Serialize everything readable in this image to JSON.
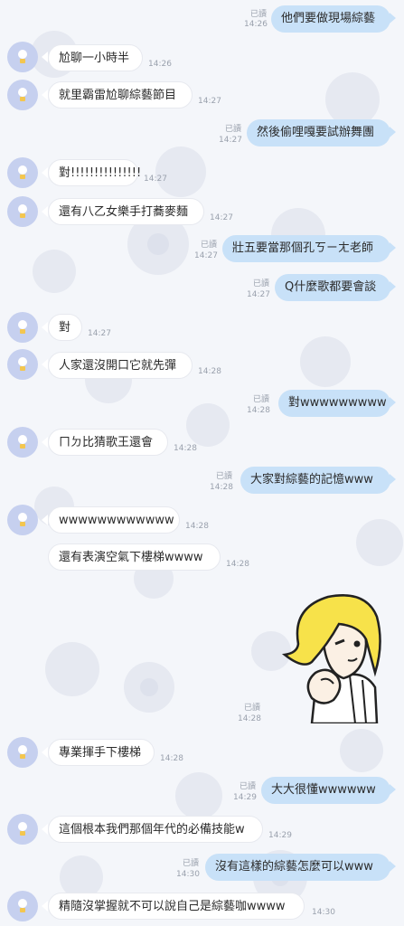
{
  "chat": {
    "messages": [
      {
        "side": "out",
        "text": "他們要做現場綜藝",
        "read": "已讀",
        "time": "14:26"
      },
      {
        "side": "in",
        "text": "尬聊一小時半",
        "time": "14:26"
      },
      {
        "side": "in",
        "text": "就里霸雷尬聊綜藝節目",
        "time": "14:27"
      },
      {
        "side": "out",
        "text": "然後偷哩嘎要試辦舞團",
        "read": "已讀",
        "time": "14:27"
      },
      {
        "side": "in",
        "text": "對!!!!!!!!!!!!!!!",
        "time": "14:27"
      },
      {
        "side": "in",
        "text": "還有八乙女樂手打蕎麥麵",
        "time": "14:27"
      },
      {
        "side": "out",
        "text": "壯五要當那個孔ㄎㄧㄤ老師",
        "read": "已讀",
        "time": "14:27"
      },
      {
        "side": "out",
        "text": "Q什麼歌都要會談",
        "read": "已讀",
        "time": "14:27"
      },
      {
        "side": "in",
        "text": "對",
        "time": "14:27"
      },
      {
        "side": "in",
        "text": "人家還沒開口它就先彈",
        "time": "14:28"
      },
      {
        "side": "out",
        "text": "對wwwwwwwww",
        "read": "已讀",
        "time": "14:28"
      },
      {
        "side": "in",
        "text": "ㄇㄉ比猜歌王還會",
        "time": "14:28"
      },
      {
        "side": "out",
        "text": "大家對綜藝的記憶www",
        "read": "已讀",
        "time": "14:28"
      },
      {
        "side": "in",
        "text": "wwwwwwwwwwww",
        "time": "14:28"
      },
      {
        "side": "in",
        "text": "還有表演空氣下樓梯wwww",
        "time": "14:28"
      },
      {
        "side": "out",
        "sticker": "pointing-blonde-girl-sticker",
        "read": "已讀",
        "time": "14:28"
      },
      {
        "side": "in",
        "text": "專業揮手下樓梯",
        "time": "14:28"
      },
      {
        "side": "out",
        "text": "大大很懂wwwwww",
        "read": "已讀",
        "time": "14:29"
      },
      {
        "side": "in",
        "text": "這個根本我們那個年代的必備技能w",
        "time": "14:29"
      },
      {
        "side": "out",
        "text": "沒有這樣的綜藝怎麼可以www",
        "read": "已讀",
        "time": "14:30"
      },
      {
        "side": "in",
        "text": "精隨沒掌握就不可以說自己是綜藝咖wwww",
        "time": "14:30"
      }
    ]
  },
  "colors": {
    "outgoing": "#c8e1f8",
    "incoming": "#ffffff",
    "avatar": "#c6d0ef",
    "background": "#f4f6fa"
  }
}
